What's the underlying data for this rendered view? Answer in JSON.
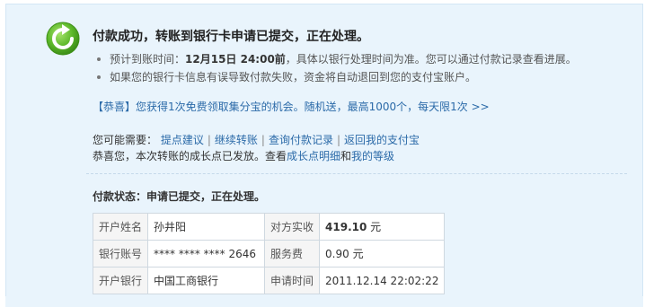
{
  "title": "付款成功，转账到银行卡申请已提交，正在处理。",
  "bullets": {
    "arrival_prefix": "预计到账时间：",
    "arrival_time": "12月15日 24:00前",
    "arrival_suffix": "，具体以银行处理时间为准。您可以通过付款记录查看进展。",
    "refund_note": "如果您的银行卡信息有误导致付款失败，资金将自动退回到您的支付宝账户。"
  },
  "promo": "【恭喜】您获得1次免费领取集分宝的机会。随机送，最高1000个，每天限1次 >>",
  "links": {
    "label": "您可能需要：",
    "items": [
      "提点建议",
      "继续转账",
      "查询付款记录",
      "返回我的支付宝"
    ],
    "separator": "|"
  },
  "growth": {
    "text": "恭喜您，本次转账的成长点已发放。查看",
    "link1": "成长点明细",
    "and": "和",
    "link2": "我的等级"
  },
  "status": "付款状态：申请已提交，正在处理。",
  "table": {
    "name_label": "开户姓名",
    "name_value": "孙井阳",
    "received_label": "对方实收",
    "received_amount": "419.10",
    "received_unit": " 元",
    "account_label": "银行账号",
    "account_value": "**** **** **** 2646",
    "fee_label": "服务费",
    "fee_value": "0.90 元",
    "bank_label": "开户银行",
    "bank_value": "中国工商银行",
    "time_label": "申请时间",
    "time_value": "2011.12.14 22:02:22"
  },
  "colors": {
    "panel_bg": "#e9f4fc",
    "link": "#2b6aa8",
    "success_icon": "#5cb82a"
  },
  "icon": "success-refresh-icon"
}
